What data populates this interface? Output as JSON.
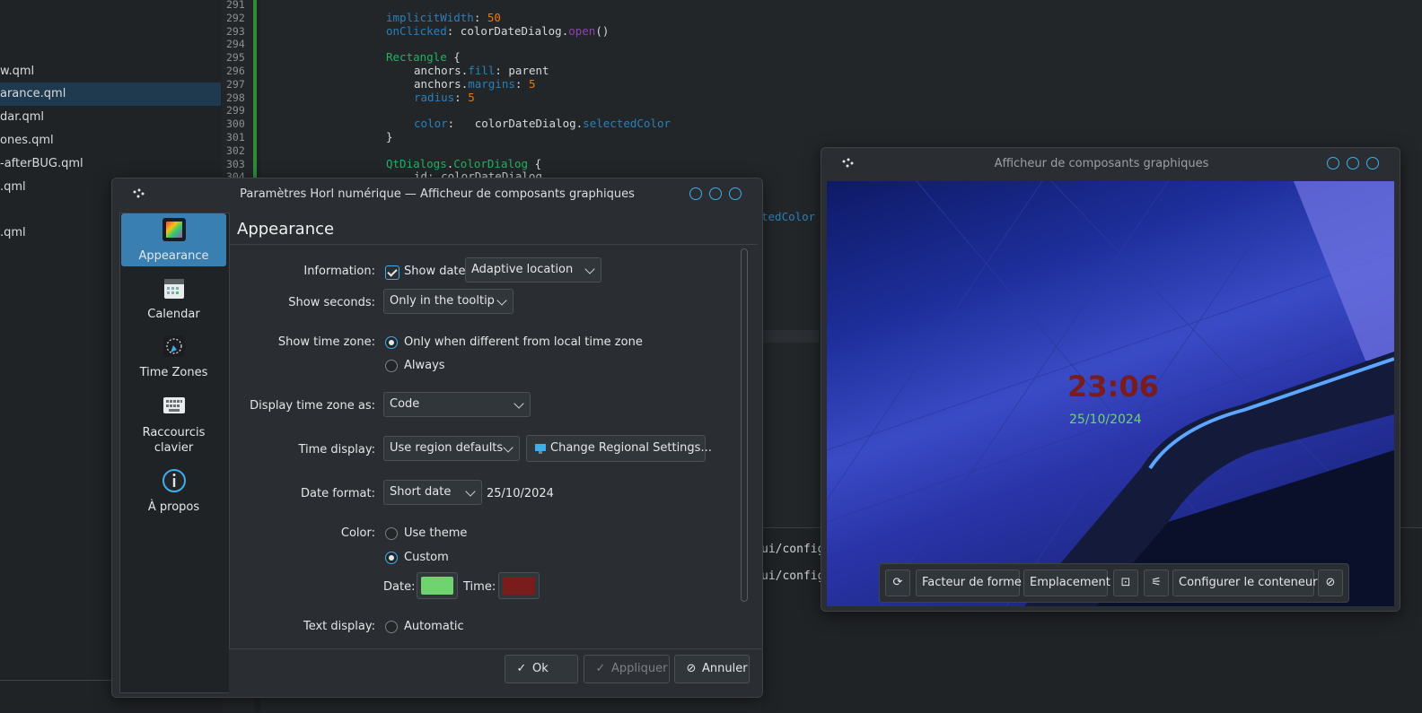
{
  "editor": {
    "files": [
      {
        "label": "w.qml",
        "selected": false
      },
      {
        "label": "arance.qml",
        "selected": true
      },
      {
        "label": "dar.qml",
        "selected": false
      },
      {
        "label": "ones.qml",
        "selected": false
      },
      {
        "label": "-afterBUG.qml",
        "selected": false
      },
      {
        "label": ".qml",
        "selected": false
      },
      {
        "label": ".qml",
        "selected": false
      }
    ],
    "line_numbers": [
      "291",
      "292",
      "293",
      "294",
      "295",
      "296",
      "297",
      "298",
      "299",
      "300",
      "301",
      "302",
      "303",
      "304"
    ],
    "code": {
      "l292_key": "implicitWidth",
      "l292_val": "50",
      "l293_key": "onClicked",
      "l293_obj": "colorDateDialog",
      "l293_fn": "open",
      "l295_type": "Rectangle",
      "l296_key": "anchors",
      "l296_prop": "fill",
      "l296_val": "parent",
      "l297_key": "anchors",
      "l297_prop": "margins",
      "l297_val": "5",
      "l298_key": "radius",
      "l298_val": "5",
      "l300_key": "color",
      "l300_obj": "colorDateDialog",
      "l300_prop": "selectedColor",
      "l301": "}",
      "l303_mod": "QtDialogs",
      "l303_type": "ColorDialog",
      "l304": "id: colorDateDialog",
      "peek": "tedColor"
    },
    "bottom_lines": [
      "ui/config",
      "ui/config"
    ]
  },
  "dialog": {
    "title": "Paramètres Horl numérique — Afficheur de composants graphiques",
    "sidebar": [
      {
        "label": "Appearance",
        "icon": "appearance-icon",
        "active": true
      },
      {
        "label": "Calendar",
        "icon": "calendar-icon",
        "active": false
      },
      {
        "label": "Time Zones",
        "icon": "time-zones-icon",
        "active": false
      },
      {
        "label": "Raccourcis clavier",
        "icon": "keyboard-icon",
        "active": false
      },
      {
        "label": "À propos",
        "icon": "info-icon",
        "active": false
      }
    ],
    "page_title": "Appearance",
    "information": {
      "label": "Information:",
      "show_date": "Show date",
      "show_date_checked": true,
      "location": "Adaptive location"
    },
    "seconds": {
      "label": "Show seconds:",
      "value": "Only in the tooltip"
    },
    "timezone": {
      "label": "Show time zone:",
      "opt1": "Only when different from local time zone",
      "opt2": "Always",
      "selected": "opt1"
    },
    "tz_display": {
      "label": "Display time zone as:",
      "value": "Code"
    },
    "time_display": {
      "label": "Time display:",
      "value": "Use region defaults",
      "button": "Change Regional Settings..."
    },
    "date_format": {
      "label": "Date format:",
      "value": "Short date",
      "preview": "25/10/2024"
    },
    "color": {
      "label": "Color:",
      "opt1": "Use theme",
      "opt2": "Custom",
      "selected": "opt2",
      "date_label": "Date:",
      "time_label": "Time:",
      "date_color": "#6fd46f",
      "time_color": "#7a1c1c"
    },
    "text_display": {
      "label": "Text display:",
      "opt1": "Automatic"
    },
    "footer": {
      "ok": "Ok",
      "apply": "Appliquer",
      "cancel": "Annuler"
    }
  },
  "viewer": {
    "title": "Afficheur de composants graphiques",
    "clock_time": "23:06",
    "clock_date": "25/10/2024",
    "toolbar": {
      "form_factor": "Facteur de forme",
      "location": "Emplacement",
      "configure": "Configurer le conteneur"
    }
  },
  "colors": {
    "accent": "#3daee9",
    "selection": "#3a7fb1"
  }
}
